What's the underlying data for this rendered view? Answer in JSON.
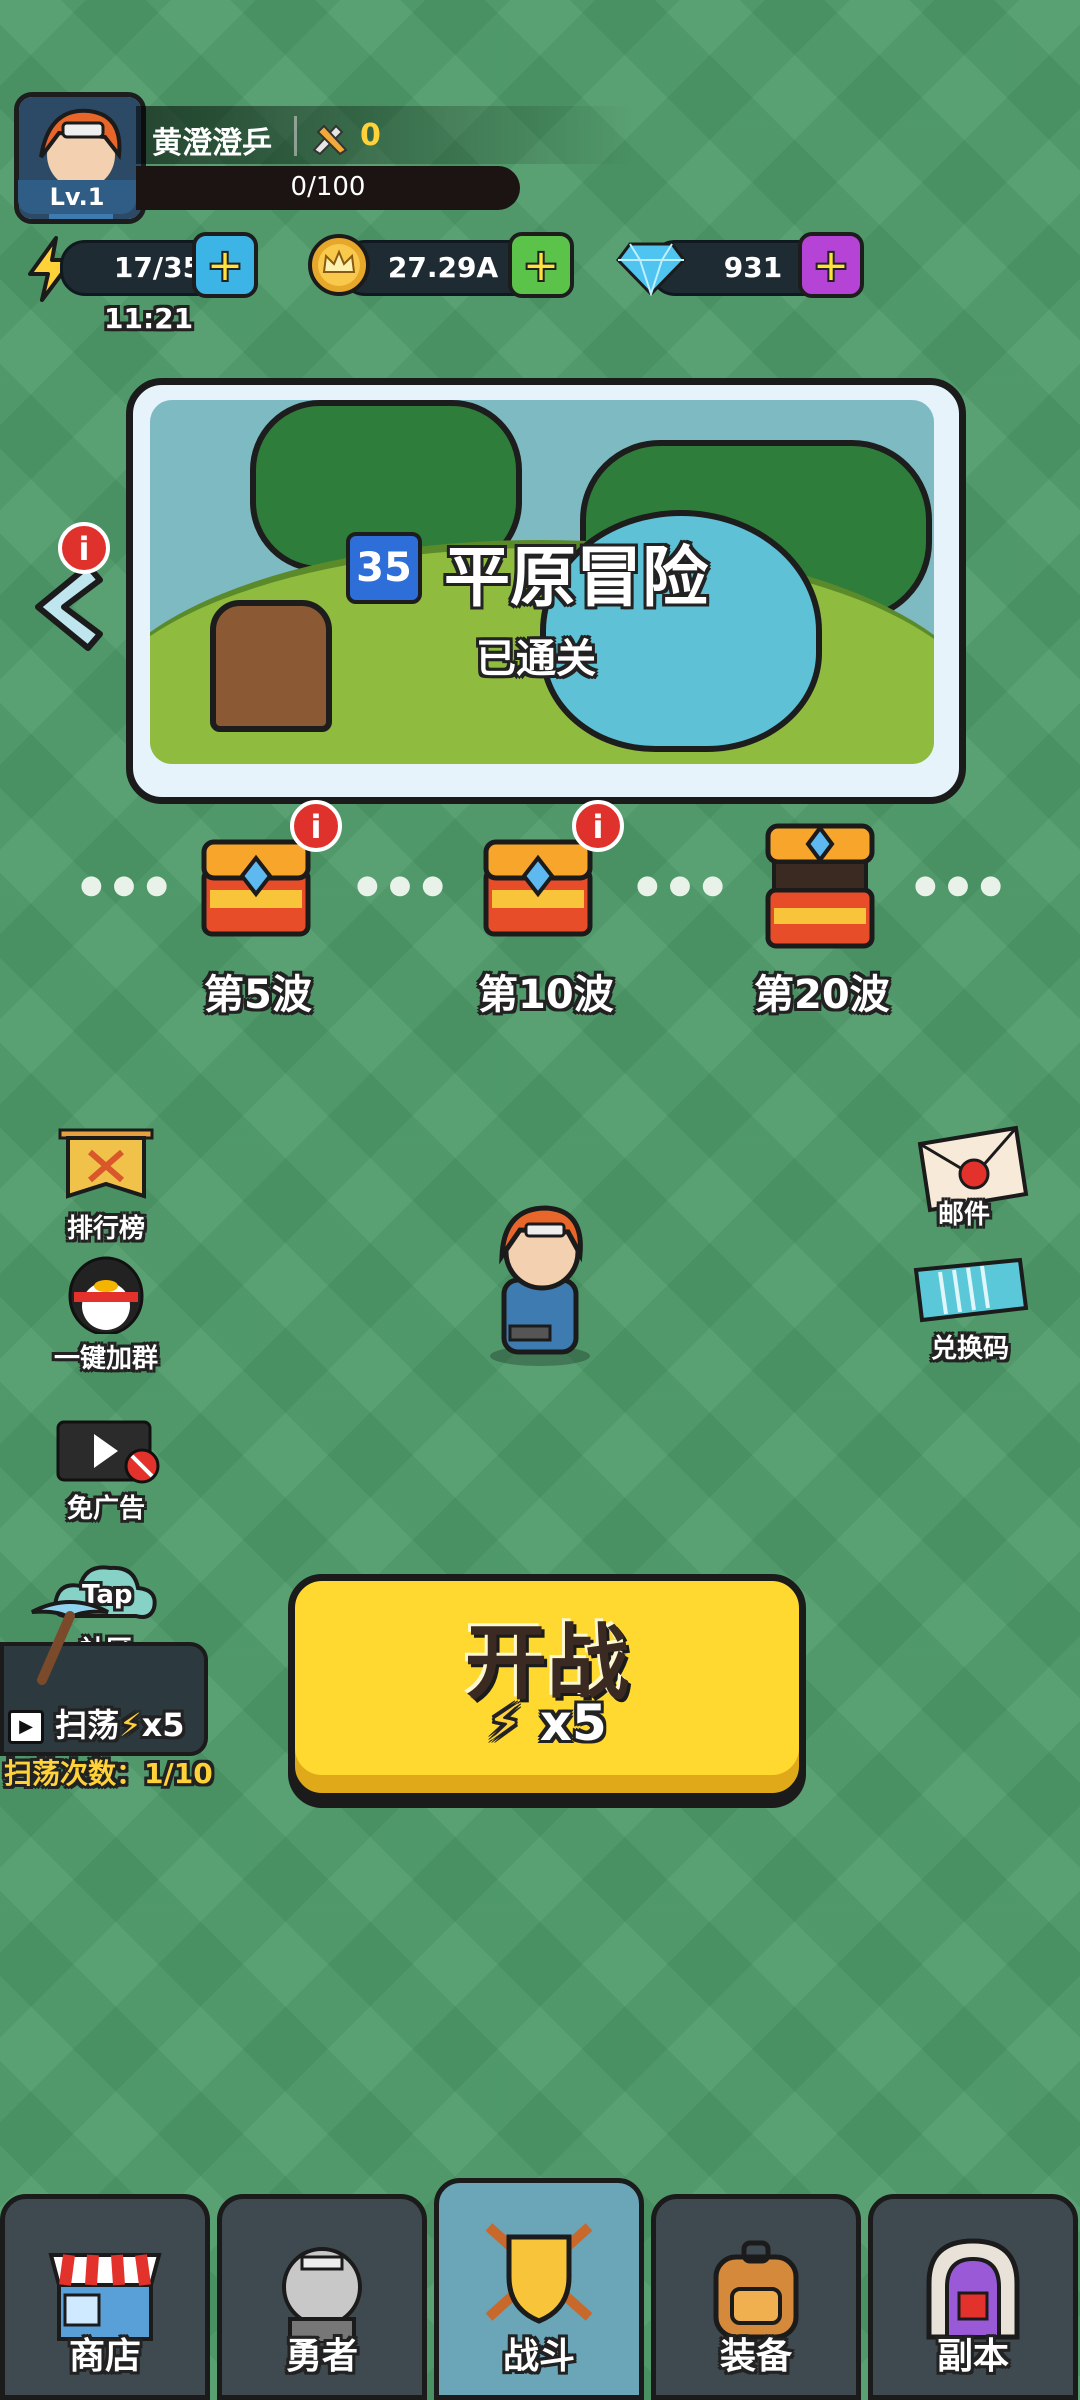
{
  "player": {
    "name": "黄澄澄乒",
    "level": "Lv.1",
    "power": "0",
    "xp": "0/100"
  },
  "resources": {
    "energy": "17/35",
    "energy_timer": "11:21",
    "gold": "27.29A",
    "gems": "931"
  },
  "stage": {
    "number": "35",
    "title": "平原冒险",
    "status": "已通关"
  },
  "rewards": [
    {
      "label": "第5波",
      "badge": "i"
    },
    {
      "label": "第10波",
      "badge": "i"
    },
    {
      "label": "第20波"
    }
  ],
  "side_left": {
    "ranking": "排行榜",
    "qq_group": "一键加群",
    "no_ads": "免广告",
    "tap_logo": "Tap",
    "community": "社区"
  },
  "side_right": {
    "mail": "邮件",
    "redeem": "兑换码"
  },
  "sweep": {
    "label": "扫荡",
    "cost": "x5",
    "count": "扫荡次数：1/10"
  },
  "start": {
    "label": "开战",
    "cost": "x5"
  },
  "nav": [
    {
      "label": "商店"
    },
    {
      "label": "勇者"
    },
    {
      "label": "战斗"
    },
    {
      "label": "装备"
    },
    {
      "label": "副本"
    }
  ],
  "colors": {
    "background": "#4d9a68",
    "start_button": "#ffd92f",
    "badge": "#e0322c",
    "plus_energy": "#3cb4e6",
    "plus_gold": "#5bc34a",
    "plus_gems": "#b543d6"
  },
  "icons": {
    "energy": "lightning-icon",
    "gold": "crown-coin-icon",
    "gems": "diamond-icon"
  }
}
